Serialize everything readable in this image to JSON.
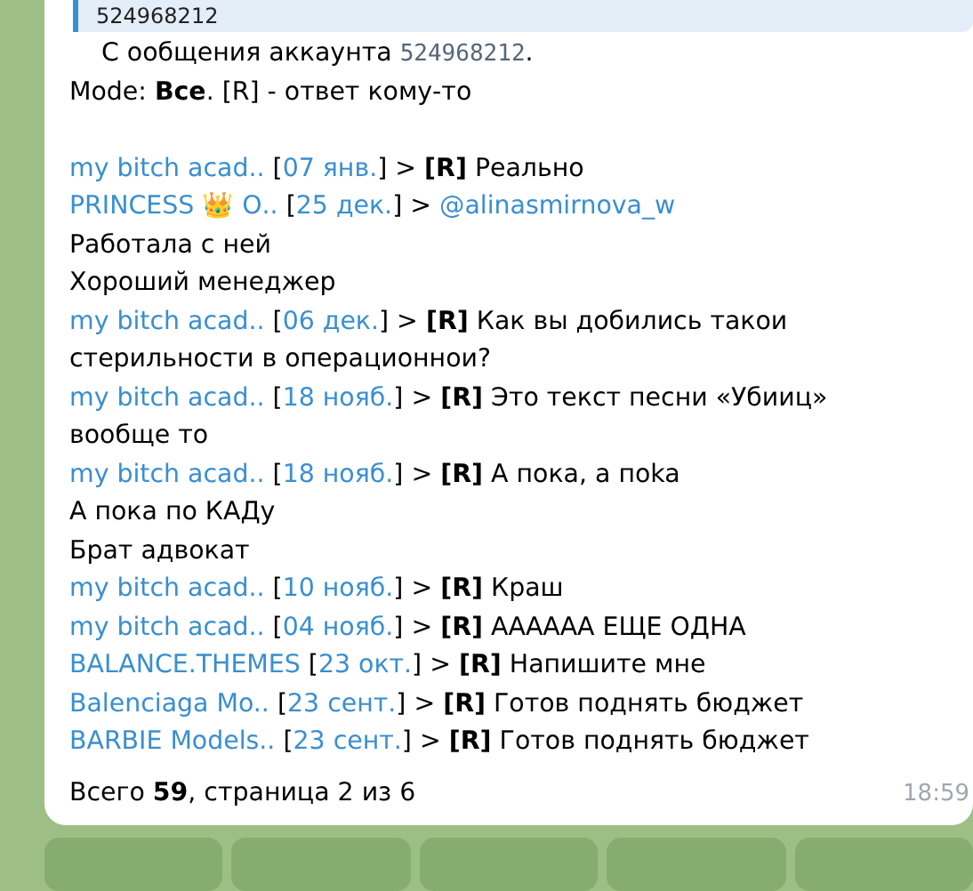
{
  "quote": {
    "text": "524968212"
  },
  "header": {
    "prefix": "С ообщения аккаунта ",
    "account": "524968212",
    "suffix": "."
  },
  "mode": {
    "label": "Mode: ",
    "value": "Все",
    "rest": ". [R] - ответ кому-то"
  },
  "messages": [
    {
      "kind": "entry",
      "sender": "my bitch acad..",
      "open": "[",
      "date": "07 янв.",
      "close": "] >",
      "tag": "[R]",
      "text": "Реально"
    },
    {
      "kind": "entry",
      "sender": "PRINCESS 👑 О..",
      "open": "[",
      "date": "25 дек.",
      "close": "] >",
      "mention": "@alinasmirnova_w"
    },
    {
      "kind": "line",
      "text": "Работала с ней"
    },
    {
      "kind": "line",
      "text": "Хороший менеджер"
    },
    {
      "kind": "entry",
      "sender": "my bitch acad..",
      "open": "[",
      "date": "06 дек.",
      "close": "] >",
      "tag": "[R]",
      "text": "Как вы добились такои стерильности в операционнои?"
    },
    {
      "kind": "entry",
      "sender": "my bitch acad..",
      "open": "[",
      "date": "18 нояб.",
      "close": "] >",
      "tag": "[R]",
      "text": "Это текст песни «Убииц» вообще то"
    },
    {
      "kind": "entry",
      "sender": "my bitch acad..",
      "open": "[",
      "date": "18 нояб.",
      "close": "] >",
      "tag": "[R]",
      "text": "А пока, а поka"
    },
    {
      "kind": "line",
      "text": "А пока по КАДу"
    },
    {
      "kind": "line",
      "text": "Брат адвокат"
    },
    {
      "kind": "entry",
      "sender": "my bitch acad..",
      "open": "[",
      "date": "10 нояб.",
      "close": "] >",
      "tag": "[R]",
      "text": "Краш"
    },
    {
      "kind": "entry",
      "sender": "my bitch acad..",
      "open": "[",
      "date": "04 нояб.",
      "close": "] >",
      "tag": "[R]",
      "text": "АААААА ЕЩЕ ОДНА"
    },
    {
      "kind": "entry",
      "sender": "BALANCE.THEMES",
      "open": "[",
      "date": "23 окт.",
      "close": "] >",
      "tag": "[R]",
      "text": "Напишите мне"
    },
    {
      "kind": "entry",
      "sender": "Balenciaga Mo..",
      "open": "[",
      "date": "23 сент.",
      "close": "] >",
      "tag": "[R]",
      "text": "Готов поднять бюджет"
    },
    {
      "kind": "entry",
      "sender": "BARBIE Models..",
      "open": "[",
      "date": "23 сент.",
      "close": "] >",
      "tag": "[R]",
      "text": "Готов поднять бюджет"
    }
  ],
  "footer": "Всего **59**, страница 2 из 6",
  "time": "18:59"
}
